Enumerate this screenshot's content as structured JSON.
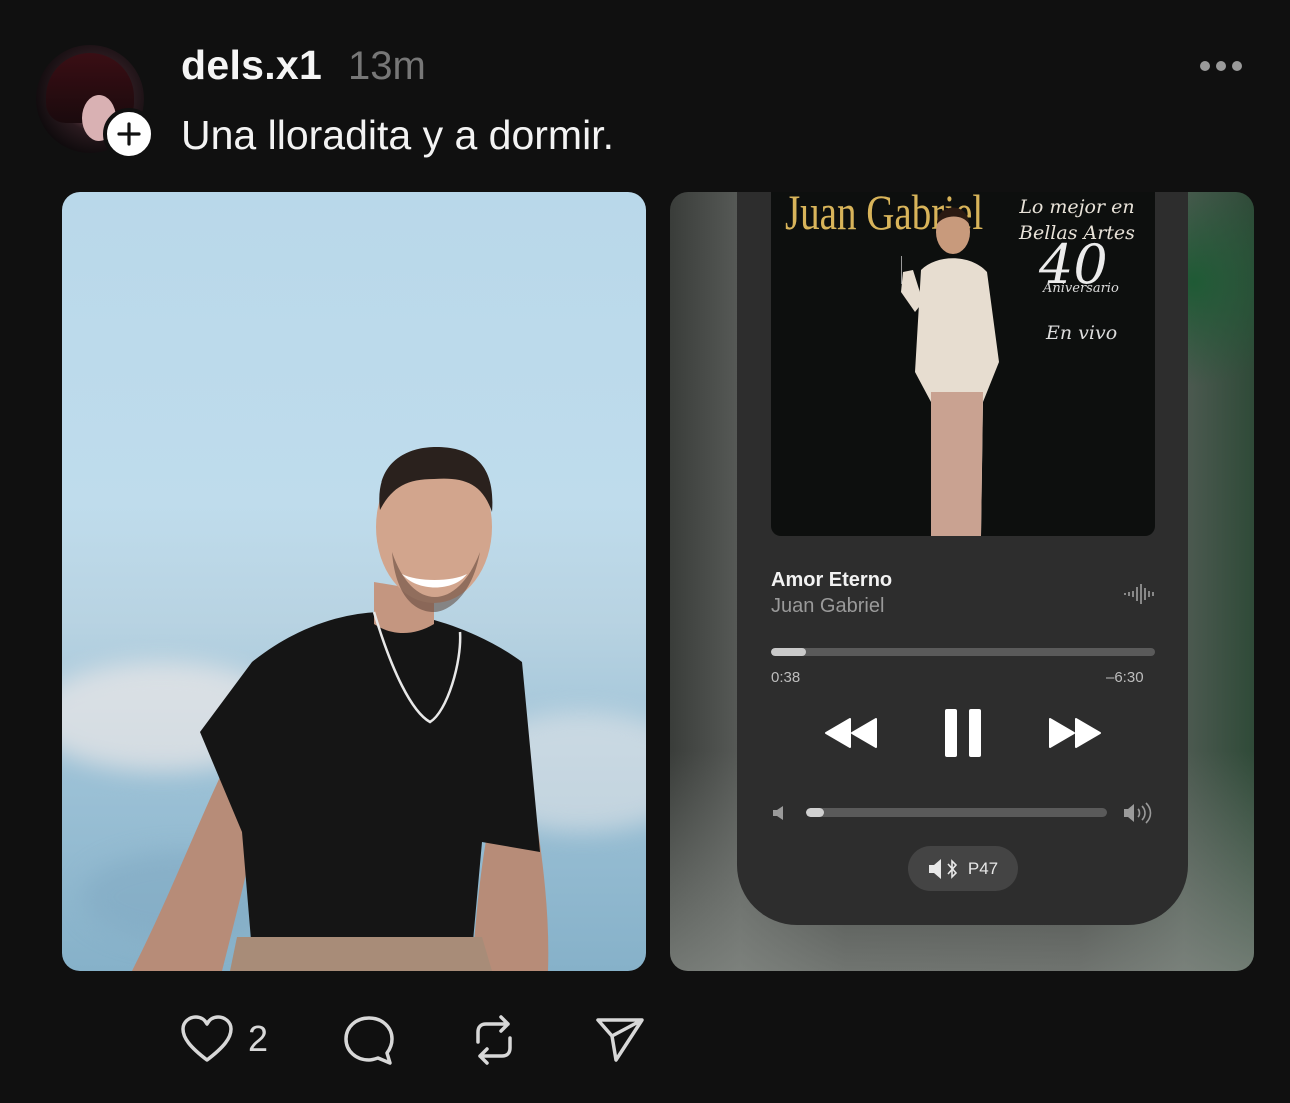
{
  "post": {
    "username": "dels.x1",
    "time": "13m",
    "caption": "Una lloradita y a dormir.",
    "like_count": "2"
  },
  "album": {
    "artist_logo": "Juan Gabriel",
    "title_line1": "Lo mejor en",
    "title_line2": "Bellas Artes",
    "number": "40",
    "subtitle": "Aniversario",
    "edition": "En vivo"
  },
  "player": {
    "song_title": "Amor Eterno",
    "song_artist": "Juan Gabriel",
    "elapsed": "0:38",
    "remaining": "–6:30",
    "progress": 0.09,
    "volume": 0.06,
    "output_device": "P47"
  },
  "icons": {
    "follow": "plus-icon",
    "more": "ellipsis-icon",
    "like": "heart-icon",
    "reply": "comment-icon",
    "repost": "repost-icon",
    "share": "send-icon"
  }
}
